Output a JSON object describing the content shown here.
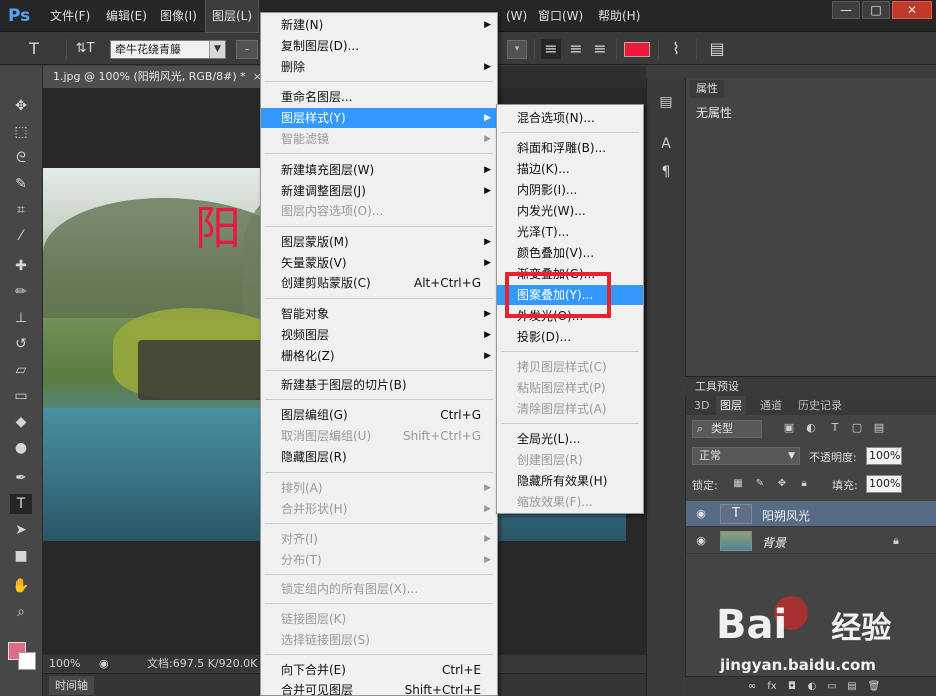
{
  "menubar": {
    "logo": "Ps",
    "items": [
      "文件(F)",
      "编辑(E)",
      "图像(I)",
      "图层(L)",
      "(W)",
      "窗口(W)",
      "帮助(H)"
    ],
    "window_buttons": {
      "minimize": "—",
      "maximize": "□",
      "close": "✕"
    }
  },
  "options": {
    "tool_glyph": "T",
    "orient_glyph": "⇅T",
    "font_family": "牵牛花绕青籐",
    "align_left": "≡",
    "align_center": "≡",
    "align_right": "≡",
    "text_color": "#ee1a3c",
    "warp_glyph": "⌇",
    "panels_glyph": "▤"
  },
  "document": {
    "tab_title": "1.jpg @ 100% (阳朔风光, RGB/8#) *",
    "close_glyph": "×",
    "canvas_text": "阳",
    "zoom": "100%",
    "doc_info": "文档:697.5 K/920.0K",
    "timeline_label": "时间轴"
  },
  "properties": {
    "tab_label": "属性",
    "empty_text": "无属性"
  },
  "presets": {
    "tab_label": "工具预设"
  },
  "layers": {
    "tabs": [
      "3D",
      "图层",
      "通道",
      "历史记录"
    ],
    "filter_label": "类型",
    "blend_mode": "正常",
    "opacity_label": "不透明度:",
    "opacity_value": "100%",
    "lock_label": "锁定:",
    "fill_label": "填充:",
    "fill_value": "100%",
    "rows": [
      {
        "name": "阳朔风光",
        "thumb": "T",
        "selected": true
      },
      {
        "name": "背景",
        "thumb": "",
        "selected": false
      }
    ]
  },
  "layer_menu": {
    "items": [
      {
        "label": "新建(N)",
        "shortcut": "",
        "submenu": true,
        "disabled": false
      },
      {
        "label": "复制图层(D)...",
        "shortcut": "",
        "submenu": false,
        "disabled": false
      },
      {
        "label": "删除",
        "shortcut": "",
        "submenu": true,
        "disabled": false
      },
      {
        "label": "重命名图层...",
        "shortcut": "",
        "submenu": false,
        "disabled": false
      },
      {
        "label": "图层样式(Y)",
        "shortcut": "",
        "submenu": true,
        "disabled": false,
        "highlight": true
      },
      {
        "label": "智能滤镜",
        "shortcut": "",
        "submenu": true,
        "disabled": true
      },
      {
        "label": "新建填充图层(W)",
        "shortcut": "",
        "submenu": true,
        "disabled": false
      },
      {
        "label": "新建调整图层(J)",
        "shortcut": "",
        "submenu": true,
        "disabled": false
      },
      {
        "label": "图层内容选项(O)...",
        "shortcut": "",
        "submenu": false,
        "disabled": true
      },
      {
        "label": "图层蒙版(M)",
        "shortcut": "",
        "submenu": true,
        "disabled": false
      },
      {
        "label": "矢量蒙版(V)",
        "shortcut": "",
        "submenu": true,
        "disabled": false
      },
      {
        "label": "创建剪贴蒙版(C)",
        "shortcut": "Alt+Ctrl+G",
        "submenu": false,
        "disabled": false
      },
      {
        "label": "智能对象",
        "shortcut": "",
        "submenu": true,
        "disabled": false
      },
      {
        "label": "视频图层",
        "shortcut": "",
        "submenu": true,
        "disabled": false
      },
      {
        "label": "栅格化(Z)",
        "shortcut": "",
        "submenu": true,
        "disabled": false
      },
      {
        "label": "新建基于图层的切片(B)",
        "shortcut": "",
        "submenu": false,
        "disabled": false
      },
      {
        "label": "图层编组(G)",
        "shortcut": "Ctrl+G",
        "submenu": false,
        "disabled": false
      },
      {
        "label": "取消图层编组(U)",
        "shortcut": "Shift+Ctrl+G",
        "submenu": false,
        "disabled": true
      },
      {
        "label": "隐藏图层(R)",
        "shortcut": "",
        "submenu": false,
        "disabled": false
      },
      {
        "label": "排列(A)",
        "shortcut": "",
        "submenu": true,
        "disabled": true
      },
      {
        "label": "合并形状(H)",
        "shortcut": "",
        "submenu": true,
        "disabled": true
      },
      {
        "label": "对齐(I)",
        "shortcut": "",
        "submenu": true,
        "disabled": true
      },
      {
        "label": "分布(T)",
        "shortcut": "",
        "submenu": true,
        "disabled": true
      },
      {
        "label": "锁定组内的所有图层(X)...",
        "shortcut": "",
        "submenu": false,
        "disabled": true
      },
      {
        "label": "链接图层(K)",
        "shortcut": "",
        "submenu": false,
        "disabled": true
      },
      {
        "label": "选择链接图层(S)",
        "shortcut": "",
        "submenu": false,
        "disabled": true
      },
      {
        "label": "向下合并(E)",
        "shortcut": "Ctrl+E",
        "submenu": false,
        "disabled": false
      },
      {
        "label": "合并可见图层",
        "shortcut": "Shift+Ctrl+E",
        "submenu": false,
        "disabled": false
      }
    ]
  },
  "style_submenu": {
    "items": [
      {
        "label": "混合选项(N)...",
        "disabled": false
      },
      {
        "label": "斜面和浮雕(B)...",
        "disabled": false
      },
      {
        "label": "描边(K)...",
        "disabled": false
      },
      {
        "label": "内阴影(I)...",
        "disabled": false
      },
      {
        "label": "内发光(W)...",
        "disabled": false
      },
      {
        "label": "光泽(T)...",
        "disabled": false
      },
      {
        "label": "颜色叠加(V)...",
        "disabled": false
      },
      {
        "label": "渐变叠加(G)...",
        "disabled": false
      },
      {
        "label": "图案叠加(Y)...",
        "disabled": false,
        "highlight": true
      },
      {
        "label": "外发光(O)...",
        "disabled": false
      },
      {
        "label": "投影(D)...",
        "disabled": false
      },
      {
        "label": "拷贝图层样式(C)",
        "disabled": true
      },
      {
        "label": "粘贴图层样式(P)",
        "disabled": true
      },
      {
        "label": "清除图层样式(A)",
        "disabled": true
      },
      {
        "label": "全局光(L)...",
        "disabled": false
      },
      {
        "label": "创建图层(R)",
        "disabled": true
      },
      {
        "label": "隐藏所有效果(H)",
        "disabled": false
      },
      {
        "label": "缩放效果(F)...",
        "disabled": true
      }
    ]
  },
  "watermark": {
    "logo": "Bai",
    "logo_tail": "经验",
    "url": "jingyan.baidu.com"
  },
  "colors": {
    "menu_highlight": "#3399ff",
    "foreground": "#de6b86",
    "background": "#ffffff",
    "callout_red": "#e8232d"
  },
  "icons": {
    "tools": [
      "move-icon",
      "marquee-icon",
      "lasso-icon",
      "quick-select-icon",
      "crop-icon",
      "eyedropper-icon",
      "healing-icon",
      "brush-icon",
      "stamp-icon",
      "history-brush-icon",
      "eraser-icon",
      "gradient-icon",
      "blur-icon",
      "dodge-icon",
      "pen-icon",
      "type-icon",
      "path-select-icon",
      "rectangle-icon",
      "hand-icon",
      "zoom-icon"
    ]
  }
}
